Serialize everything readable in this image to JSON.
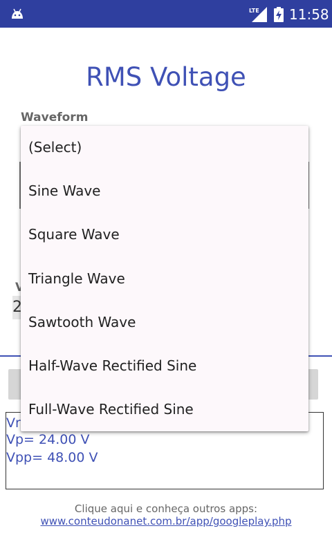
{
  "status_bar": {
    "time": "11:58",
    "network": "LTE",
    "icons": [
      "android-icon",
      "lte-signal-icon",
      "battery-charging-icon"
    ]
  },
  "page": {
    "title": "RMS Voltage",
    "waveform_label": "Waveform",
    "hidden_label_fragment": "V",
    "hidden_input_fragment": "2"
  },
  "dropdown": {
    "options": [
      "(Select)",
      "Sine Wave",
      "Square Wave",
      "Triangle Wave",
      "Sawtooth Wave",
      "Half-Wave Rectified Sine",
      "Full-Wave Rectified Sine"
    ]
  },
  "results": {
    "line1": "Vr",
    "line2": "Vp= 24.00 V",
    "line3": "Vpp= 48.00 V"
  },
  "footer": {
    "text": "Clique aqui e conheça outros apps:",
    "link": "www.conteudonanet.com.br/app/googleplay.php"
  },
  "colors": {
    "primary": "#3f51b5",
    "status_bar": "#2f3f9f",
    "popup_background": "#fdf8fb"
  }
}
